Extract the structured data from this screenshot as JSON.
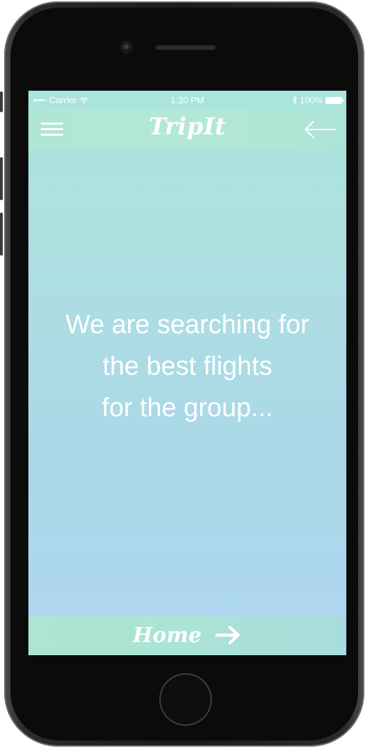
{
  "status_bar": {
    "carrier": "Carrier",
    "time": "1:20 PM",
    "battery": "100%",
    "icons": [
      "signal-dots-icon",
      "wifi-icon",
      "bluetooth-icon",
      "battery-icon"
    ]
  },
  "navbar": {
    "title": "TripIt",
    "left_icon": "hamburger-menu-icon",
    "right_icon": "back-arrow-icon"
  },
  "message": {
    "line1": "We are searching for",
    "line2": "the best flights",
    "line3": "for the group..."
  },
  "footer": {
    "label": "Home",
    "icon": "right-arrow-icon"
  },
  "colors": {
    "gradient_top": "#a9e4dd",
    "gradient_bottom": "#aed6f2",
    "bar_mint": "#b0e6d6",
    "text": "#ffffff",
    "device_body": "#1b1b1c"
  }
}
